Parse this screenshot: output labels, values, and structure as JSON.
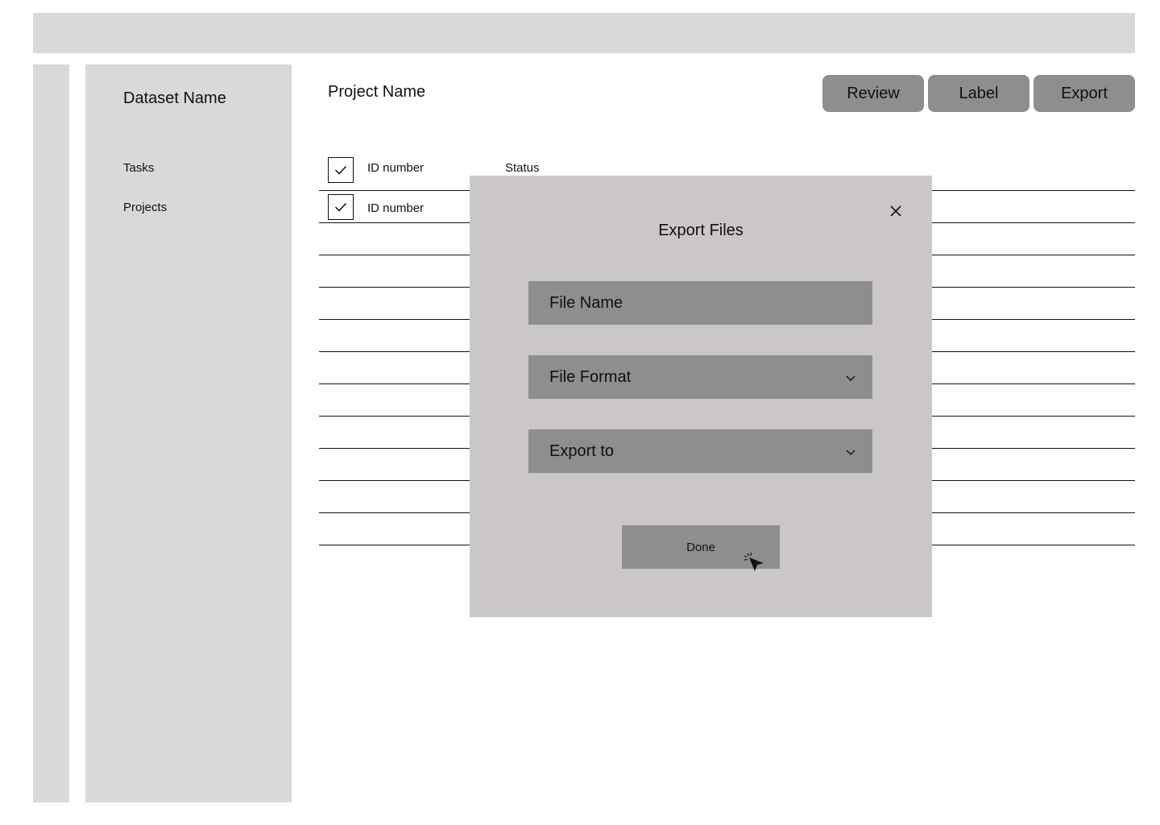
{
  "sidebar": {
    "dataset_name": "Dataset Name",
    "items": [
      {
        "label": "Tasks"
      },
      {
        "label": "Projects"
      }
    ]
  },
  "header": {
    "project_name": "Project Name",
    "buttons": {
      "review": "Review",
      "label": "Label",
      "export": "Export"
    }
  },
  "table": {
    "columns": [
      "ID number",
      "Status"
    ],
    "rows": [
      {
        "id": "ID number",
        "checked": true
      }
    ]
  },
  "modal": {
    "title": "Export Files",
    "fields": {
      "file_name": "File Name",
      "file_format": "File Format",
      "export_to": "Export to"
    },
    "done_label": "Done"
  },
  "icons": {
    "close": "close-icon",
    "checkmark": "checkmark-icon",
    "chevron": "chevron-down-icon",
    "cursor": "mouse-pointer-click-icon"
  }
}
